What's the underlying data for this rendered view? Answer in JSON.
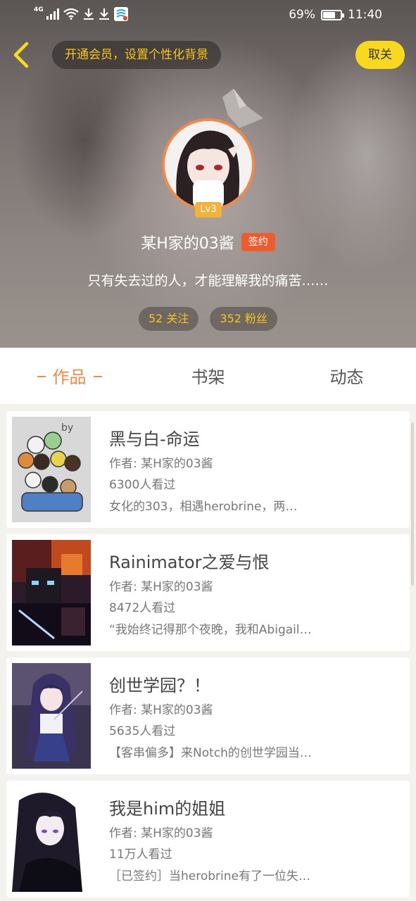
{
  "status_bar": {
    "network": "4G",
    "battery_percent": "69%",
    "battery_level": 0.69,
    "time": "11:40",
    "icons": [
      "signal-icon",
      "wifi-icon",
      "download-icon",
      "download-icon",
      "app-notification-icon",
      "battery-icon"
    ]
  },
  "header": {
    "vip_prompt": "开通会员，设置个性化背景",
    "unfollow_label": "取关",
    "level": "Lv3",
    "username": "某H家的03酱",
    "signed_badge": "签约",
    "bio": "只有失去过的人，才能理解我的痛苦……",
    "following": "52 关注",
    "followers": "352 粉丝"
  },
  "tabs": [
    {
      "label": "作品",
      "active": true
    },
    {
      "label": "书架",
      "active": false
    },
    {
      "label": "动态",
      "active": false
    }
  ],
  "colors": {
    "accent_orange": "#f08a4b",
    "accent_yellow": "#f9d920",
    "signed_red": "#ee5b2e",
    "level_gold": "#f2b33d"
  },
  "works": [
    {
      "title": "黑与白-命运",
      "author": "作者: 某H家的03酱",
      "views": "6300人看过",
      "desc": "女化的303，相遇herobrine，两…"
    },
    {
      "title": "Rainimator之爱与恨",
      "author": "作者: 某H家的03酱",
      "views": "8472人看过",
      "desc": "“我始终记得那个夜晚，我和Abigail…"
    },
    {
      "title": "创世学园？！",
      "author": "作者: 某H家的03酱",
      "views": "5635人看过",
      "desc": "【客串偏多】来Notch的创世学园当学生…"
    },
    {
      "title": "我是him的姐姐",
      "author": "作者: 某H家的03酱",
      "views": "11万人看过",
      "desc": "［已签约］当herobrine有了一位失…"
    }
  ]
}
